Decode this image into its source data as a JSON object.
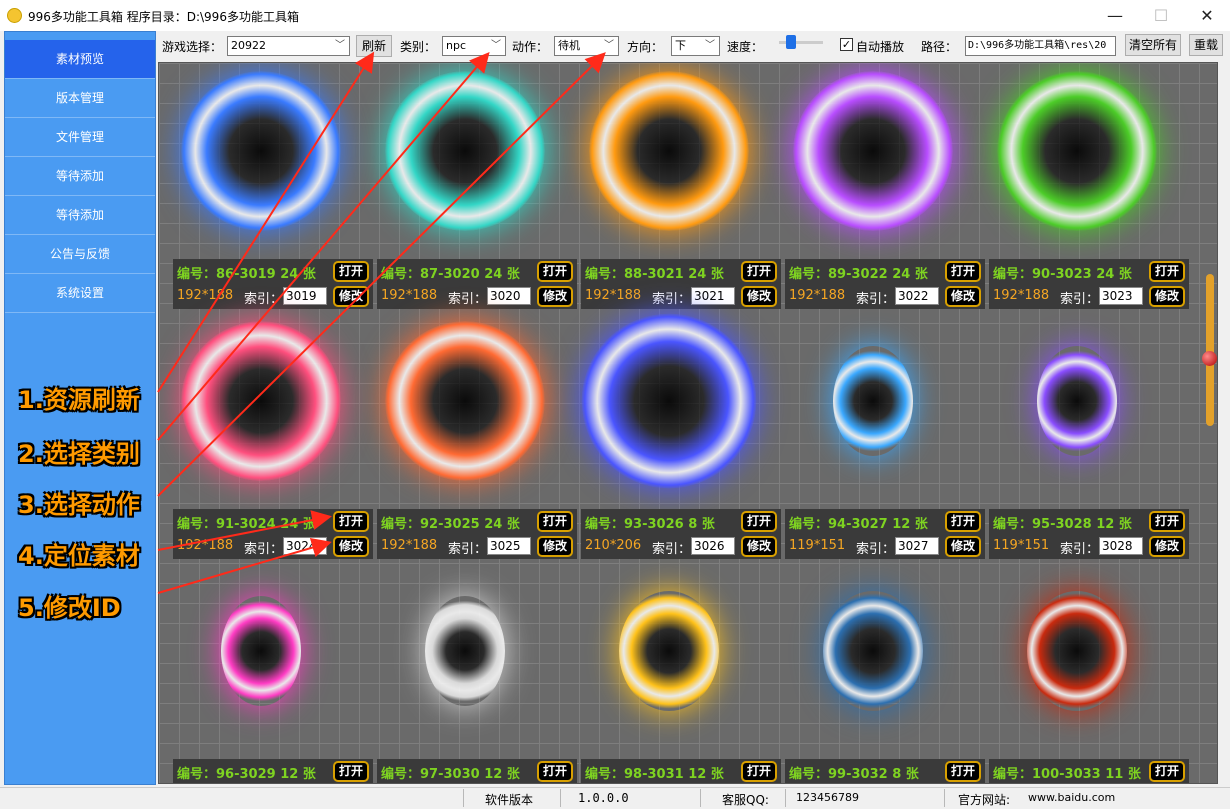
{
  "window": {
    "title": "996多功能工具箱   程序目录：D:\\996多功能工具箱",
    "minimize": "—",
    "maximize": "☐",
    "close": "✕"
  },
  "sidebar": {
    "items": [
      {
        "label": "素材预览",
        "active": true
      },
      {
        "label": "版本管理"
      },
      {
        "label": "文件管理"
      },
      {
        "label": "等待添加"
      },
      {
        "label": "等待添加"
      },
      {
        "label": "公告与反馈"
      },
      {
        "label": "系统设置"
      }
    ]
  },
  "toolbar": {
    "game_label": "游戏选择：",
    "game_value": "20922",
    "refresh": "刷新",
    "category_label": "类别：",
    "category_value": "npc",
    "action_label": "动作：",
    "action_value": "待机",
    "direction_label": "方向：",
    "direction_value": "下",
    "speed_label": "速度：",
    "autoplay_label": "自动播放",
    "autoplay_checked": "✓",
    "path_label": "路径：",
    "path_value": "D:\\996多功能工具箱\\res\\20",
    "clear_all": "清空所有",
    "reload": "重载"
  },
  "card_labels": {
    "id_prefix": "编号：",
    "count_suffix": "张",
    "index_label": "索引：",
    "open": "打开",
    "modify": "修改"
  },
  "cards": [
    {
      "code": "86-3019",
      "frames": "24",
      "size": "192*188",
      "index": "3019",
      "color": "#3a7bff"
    },
    {
      "code": "87-3020",
      "frames": "24",
      "size": "192*188",
      "index": "3020",
      "color": "#33d6c6"
    },
    {
      "code": "88-3021",
      "frames": "24",
      "size": "192*188",
      "index": "3021",
      "color": "#ff9a10"
    },
    {
      "code": "89-3022",
      "frames": "24",
      "size": "192*188",
      "index": "3022",
      "color": "#b84dff"
    },
    {
      "code": "90-3023",
      "frames": "24",
      "size": "192*188",
      "index": "3023",
      "color": "#4ccc28"
    },
    {
      "code": "91-3024",
      "frames": "24",
      "size": "192*188",
      "index": "3024",
      "color": "#ff4f7e"
    },
    {
      "code": "92-3025",
      "frames": "24",
      "size": "192*188",
      "index": "3025",
      "color": "#ff6a33"
    },
    {
      "code": "93-3026",
      "frames": "8",
      "size": "210*206",
      "index": "3026",
      "color": "#4a55ff"
    },
    {
      "code": "94-3027",
      "frames": "12",
      "size": "119*151",
      "index": "3027",
      "color": "#3aa8ff"
    },
    {
      "code": "95-3028",
      "frames": "12",
      "size": "119*151",
      "index": "3028",
      "color": "#8a4dff"
    },
    {
      "code": "96-3029",
      "frames": "12",
      "size": "",
      "index": "",
      "color": "#ff3cc4"
    },
    {
      "code": "97-3030",
      "frames": "12",
      "size": "",
      "index": "",
      "color": "#d9d9d9"
    },
    {
      "code": "98-3031",
      "frames": "12",
      "size": "",
      "index": "",
      "color": "#ffc21a"
    },
    {
      "code": "99-3032",
      "frames": "8",
      "size": "",
      "index": "",
      "color": "#2c6fb0"
    },
    {
      "code": "100-3033",
      "frames": "11",
      "size": "",
      "index": "",
      "color": "#c92a0e"
    }
  ],
  "annotations": [
    "1.资源刷新",
    "2.选择类别",
    "3.选择动作",
    "4.定位素材",
    "5.修改ID"
  ],
  "statusbar": {
    "version_label": "软件版本",
    "version_value": "1.0.0.0",
    "qq_label": "客服QQ:",
    "qq_value": "123456789",
    "site_label": "官方网站:",
    "site_value": "www.baidu.com"
  }
}
